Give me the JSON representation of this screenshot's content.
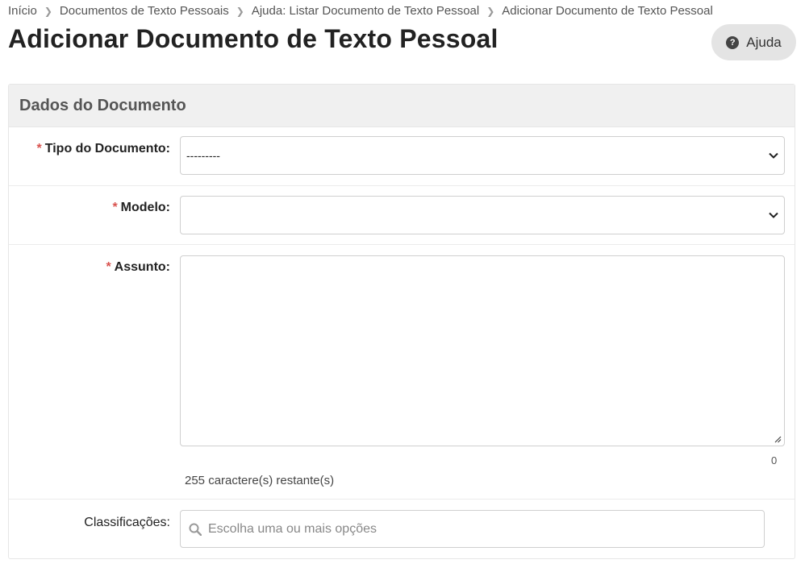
{
  "breadcrumb": {
    "items": [
      "Início",
      "Documentos de Texto Pessoais",
      "Ajuda: Listar Documento de Texto Pessoal",
      "Adicionar Documento de Texto Pessoal"
    ]
  },
  "page": {
    "title": "Adicionar Documento de Texto Pessoal"
  },
  "help_button": {
    "label": "Ajuda",
    "icon": "question-circle-icon"
  },
  "panel": {
    "title": "Dados do Documento"
  },
  "form": {
    "tipo": {
      "label": "Tipo do Documento:",
      "value": "---------",
      "required": "*"
    },
    "modelo": {
      "label": "Modelo:",
      "value": "",
      "required": "*"
    },
    "assunto": {
      "label": "Assunto:",
      "value": "",
      "required": "*",
      "count": "0",
      "remaining": "255 caractere(s) restante(s)"
    },
    "classificacoes": {
      "label": "Classificações:",
      "placeholder": "Escolha uma ou mais opções"
    }
  },
  "colors": {
    "required": "#d9534f",
    "panel_header_bg": "#f0f0f0",
    "help_bg": "#e4e4e4"
  }
}
